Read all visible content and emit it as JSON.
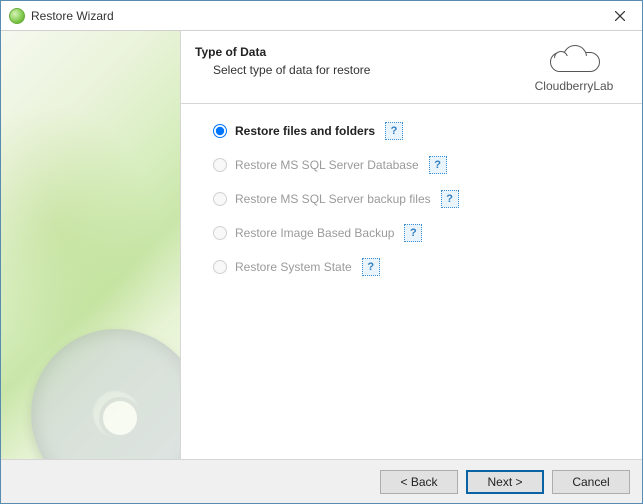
{
  "window": {
    "title": "Restore Wizard"
  },
  "header": {
    "title": "Type of Data",
    "subtitle": "Select type of data for restore"
  },
  "brand": {
    "name": "CloudberryLab"
  },
  "options": [
    {
      "label": "Restore files and folders",
      "selected": true,
      "enabled": true
    },
    {
      "label": "Restore MS SQL Server Database",
      "selected": false,
      "enabled": false
    },
    {
      "label": "Restore MS SQL Server backup files",
      "selected": false,
      "enabled": false
    },
    {
      "label": "Restore Image Based Backup",
      "selected": false,
      "enabled": false
    },
    {
      "label": "Restore System State",
      "selected": false,
      "enabled": false
    }
  ],
  "help_glyph": "?",
  "buttons": {
    "back": "< Back",
    "next": "Next >",
    "cancel": "Cancel"
  }
}
